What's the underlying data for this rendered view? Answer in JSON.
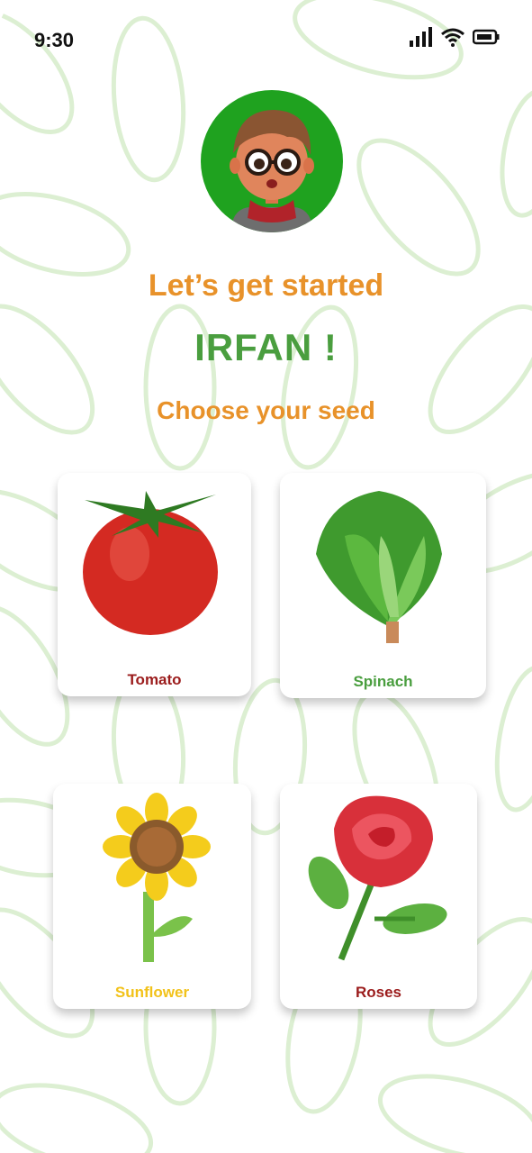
{
  "status_bar": {
    "time": "9:30"
  },
  "heading": {
    "greeting": "Let’s get started",
    "user_name": "IRFAN !",
    "prompt": "Choose your seed"
  },
  "seeds": [
    {
      "label": "Tomato",
      "icon": "tomato-icon",
      "color": "#9b1c1c"
    },
    {
      "label": "Spinach",
      "icon": "spinach-icon",
      "color": "#4a9e3f"
    },
    {
      "label": "Sunflower",
      "icon": "sunflower-icon",
      "color": "#f2c21a"
    },
    {
      "label": "Roses",
      "icon": "rose-icon",
      "color": "#9b1c1c"
    }
  ],
  "colors": {
    "accent_orange": "#e8922a",
    "accent_green": "#4a9e3f",
    "avatar_bg": "#1fa21f",
    "pattern": "#dff1d6"
  }
}
